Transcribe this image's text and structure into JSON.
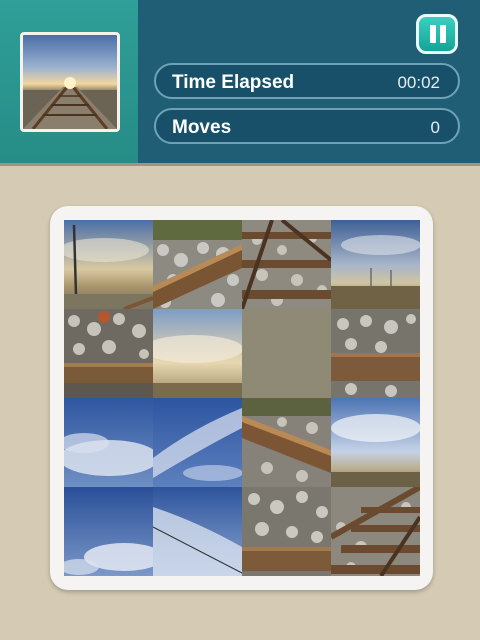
{
  "header": {
    "time_label": "Time Elapsed",
    "time_value": "00:02",
    "moves_label": "Moves",
    "moves_value": "0",
    "pause_icon": "pause-icon"
  },
  "puzzle": {
    "grid": "4x4",
    "empty_tile_position": [
      2,
      2
    ]
  },
  "colors": {
    "header_bg": "#205e76",
    "thumb_panel": "#2f9f98",
    "pause_button": "#1fb6a8",
    "page_bg": "#d5cbb4",
    "empty_tile": "#8e8a76"
  }
}
